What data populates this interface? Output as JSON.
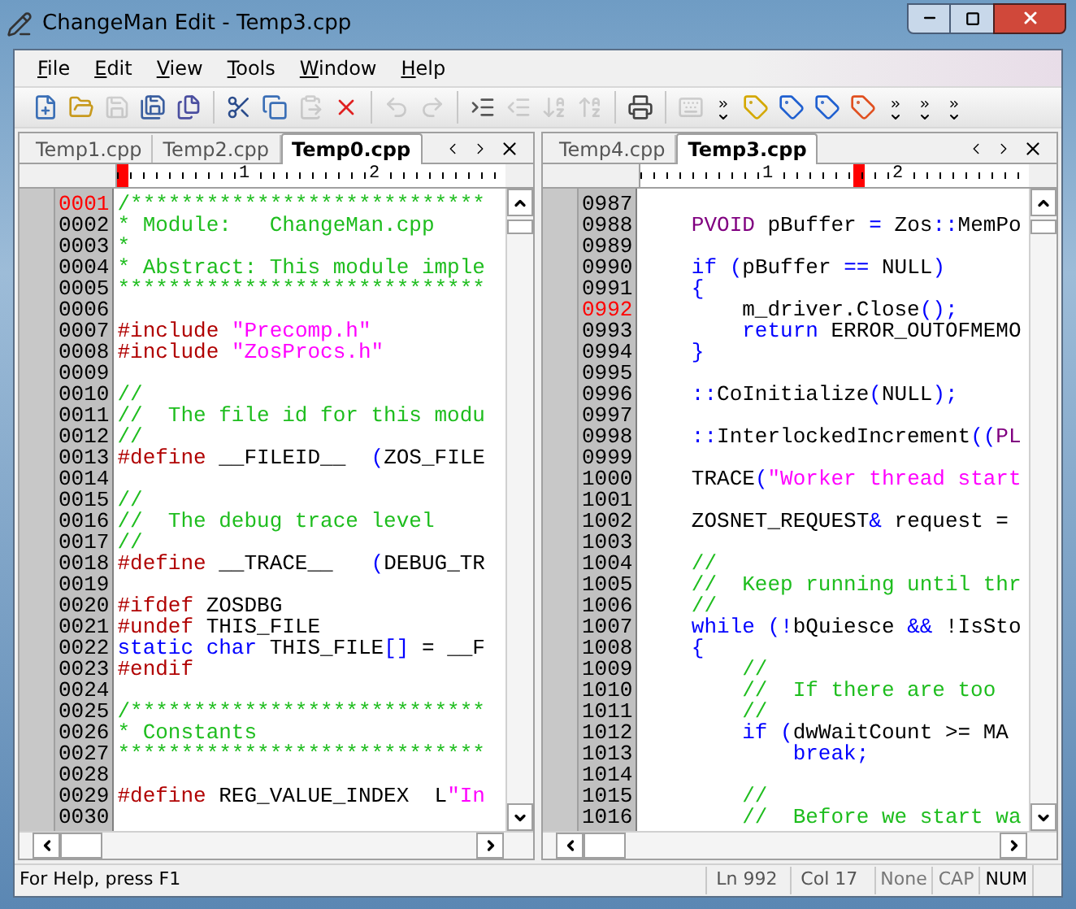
{
  "window": {
    "title": "ChangeMan Edit - Temp3.cpp"
  },
  "menu": [
    "File",
    "Edit",
    "View",
    "Tools",
    "Window",
    "Help"
  ],
  "toolbar": [
    {
      "kind": "new",
      "disabled": false
    },
    {
      "kind": "open",
      "disabled": false
    },
    {
      "kind": "save",
      "disabled": true
    },
    {
      "kind": "saveall",
      "disabled": false
    },
    {
      "kind": "saveas",
      "disabled": false
    },
    {
      "kind": "sep"
    },
    {
      "kind": "cut",
      "disabled": false
    },
    {
      "kind": "copy",
      "disabled": false
    },
    {
      "kind": "paste",
      "disabled": true
    },
    {
      "kind": "delete",
      "disabled": false
    },
    {
      "kind": "sep"
    },
    {
      "kind": "undo",
      "disabled": true
    },
    {
      "kind": "redo",
      "disabled": true
    },
    {
      "kind": "sep"
    },
    {
      "kind": "indent",
      "disabled": false
    },
    {
      "kind": "outdent",
      "disabled": true
    },
    {
      "kind": "sortdown",
      "disabled": true
    },
    {
      "kind": "sortup",
      "disabled": true
    },
    {
      "kind": "sep"
    },
    {
      "kind": "print",
      "disabled": false
    },
    {
      "kind": "sep"
    },
    {
      "kind": "keyboard",
      "disabled": true
    },
    {
      "kind": "grip"
    },
    {
      "kind": "tag",
      "disabled": false
    },
    {
      "kind": "tagnext",
      "disabled": false
    },
    {
      "kind": "tagprev",
      "disabled": false
    },
    {
      "kind": "tagclear",
      "disabled": false
    },
    {
      "kind": "grip"
    },
    {
      "kind": "grip"
    },
    {
      "kind": "grip"
    }
  ],
  "panes": [
    {
      "tabs": [
        {
          "label": "Temp1.cpp",
          "selected": false
        },
        {
          "label": "Temp2.cpp",
          "selected": false
        },
        {
          "label": "Temp0.cpp",
          "selected": true
        }
      ],
      "ruler": {
        "marks": [
          "1",
          "2"
        ],
        "level": 0
      },
      "lines": [
        {
          "no": "0001",
          "current": true,
          "tokens": [
            {
              "kind": "comment",
              "text": "/****************************"
            }
          ]
        },
        {
          "no": "0002",
          "current": false,
          "tokens": [
            {
              "kind": "comment",
              "text": "* Module:   ChangeMan.cpp"
            }
          ]
        },
        {
          "no": "0003",
          "current": false,
          "tokens": [
            {
              "kind": "comment",
              "text": "*"
            }
          ]
        },
        {
          "no": "0004",
          "current": false,
          "tokens": [
            {
              "kind": "comment",
              "text": "* Abstract: This module imple"
            }
          ]
        },
        {
          "no": "0005",
          "current": false,
          "tokens": [
            {
              "kind": "comment",
              "text": "*****************************"
            }
          ]
        },
        {
          "no": "0006",
          "current": false
        },
        {
          "no": "0007",
          "current": false,
          "tokens": [
            {
              "kind": "preproc",
              "text": "#include"
            },
            {
              "kind": "string",
              "text": " \"Precomp.h\""
            }
          ]
        },
        {
          "no": "0008",
          "current": false,
          "tokens": [
            {
              "kind": "preproc",
              "text": "#include"
            },
            {
              "kind": "string",
              "text": " \"ZosProcs.h\""
            }
          ]
        },
        {
          "no": "0009",
          "current": false
        },
        {
          "no": "0010",
          "current": false,
          "tokens": [
            {
              "kind": "comment",
              "text": "//"
            }
          ]
        },
        {
          "no": "0011",
          "current": false,
          "tokens": [
            {
              "kind": "comment",
              "text": "//  The file id for this modu"
            }
          ]
        },
        {
          "no": "0012",
          "current": false,
          "tokens": [
            {
              "kind": "comment",
              "text": "//"
            }
          ]
        },
        {
          "no": "0013",
          "current": false,
          "tokens": [
            {
              "kind": "preproc",
              "text": "#define"
            },
            {
              "kind": "plain",
              "text": " __FILEID__  "
            },
            {
              "kind": "keyword",
              "text": "("
            },
            {
              "kind": "plain",
              "text": "ZOS_FILE"
            }
          ]
        },
        {
          "no": "0014",
          "current": false
        },
        {
          "no": "0015",
          "current": false,
          "tokens": [
            {
              "kind": "comment",
              "text": "//"
            }
          ]
        },
        {
          "no": "0016",
          "current": false,
          "tokens": [
            {
              "kind": "comment",
              "text": "//  The debug trace level"
            }
          ]
        },
        {
          "no": "0017",
          "current": false,
          "tokens": [
            {
              "kind": "comment",
              "text": "//"
            }
          ]
        },
        {
          "no": "0018",
          "current": false,
          "tokens": [
            {
              "kind": "preproc",
              "text": "#define"
            },
            {
              "kind": "plain",
              "text": " __TRACE__   "
            },
            {
              "kind": "keyword",
              "text": "("
            },
            {
              "kind": "plain",
              "text": "DEBUG_TR"
            }
          ]
        },
        {
          "no": "0019",
          "current": false
        },
        {
          "no": "0020",
          "current": false,
          "tokens": [
            {
              "kind": "preproc",
              "text": "#ifdef"
            },
            {
              "kind": "plain",
              "text": " ZOSDBG"
            }
          ]
        },
        {
          "no": "0021",
          "current": false,
          "tokens": [
            {
              "kind": "preproc",
              "text": "#undef"
            },
            {
              "kind": "plain",
              "text": " THIS_FILE"
            }
          ]
        },
        {
          "no": "0022",
          "current": false,
          "tokens": [
            {
              "kind": "keyword",
              "text": "static char"
            },
            {
              "kind": "plain",
              "text": " THIS_FILE"
            },
            {
              "kind": "keyword",
              "text": "[]"
            },
            {
              "kind": "plain",
              "text": " = __F"
            }
          ]
        },
        {
          "no": "0023",
          "current": false,
          "tokens": [
            {
              "kind": "preproc",
              "text": "#endif"
            }
          ]
        },
        {
          "no": "0024",
          "current": false
        },
        {
          "no": "0025",
          "current": false,
          "tokens": [
            {
              "kind": "comment",
              "text": "/****************************"
            }
          ]
        },
        {
          "no": "0026",
          "current": false,
          "tokens": [
            {
              "kind": "comment",
              "text": "* Constants"
            }
          ]
        },
        {
          "no": "0027",
          "current": false,
          "tokens": [
            {
              "kind": "comment",
              "text": "*****************************"
            }
          ]
        },
        {
          "no": "0028",
          "current": false
        },
        {
          "no": "0029",
          "current": false,
          "tokens": [
            {
              "kind": "preproc",
              "text": "#define"
            },
            {
              "kind": "plain",
              "text": " REG_VALUE_INDEX  L"
            },
            {
              "kind": "string",
              "text": "\"In"
            }
          ]
        },
        {
          "no": "0030",
          "current": false
        }
      ]
    },
    {
      "tabs": [
        {
          "label": "Temp4.cpp",
          "selected": false
        },
        {
          "label": "Temp3.cpp",
          "selected": true
        }
      ],
      "ruler": {
        "marks": [
          "1",
          "2"
        ],
        "level": 0.55
      },
      "lines": [
        {
          "no": "0987",
          "current": false
        },
        {
          "no": "0988",
          "current": false,
          "tokens": [
            {
              "kind": "type",
              "text": "    PVOID"
            },
            {
              "kind": "plain",
              "text": " pBuffer "
            },
            {
              "kind": "keyword",
              "text": "="
            },
            {
              "kind": "plain",
              "text": " Zos"
            },
            {
              "kind": "keyword",
              "text": "::"
            },
            {
              "kind": "plain",
              "text": "MemPo"
            }
          ]
        },
        {
          "no": "0989",
          "current": false
        },
        {
          "no": "0990",
          "current": false,
          "tokens": [
            {
              "kind": "keyword",
              "text": "    if ("
            },
            {
              "kind": "plain",
              "text": "pBuffer "
            },
            {
              "kind": "keyword",
              "text": "=="
            },
            {
              "kind": "plain",
              "text": " NULL"
            },
            {
              "kind": "keyword",
              "text": ")"
            }
          ]
        },
        {
          "no": "0991",
          "current": false,
          "tokens": [
            {
              "kind": "keyword",
              "text": "    {"
            }
          ]
        },
        {
          "no": "0992",
          "current": true,
          "tokens": [
            {
              "kind": "plain",
              "text": "        m_driver.Close"
            },
            {
              "kind": "keyword",
              "text": "();"
            }
          ]
        },
        {
          "no": "0993",
          "current": false,
          "tokens": [
            {
              "kind": "keyword",
              "text": "        return"
            },
            {
              "kind": "plain",
              "text": " ERROR_OUTOFMEMO"
            }
          ]
        },
        {
          "no": "0994",
          "current": false,
          "tokens": [
            {
              "kind": "keyword",
              "text": "    }"
            }
          ]
        },
        {
          "no": "0995",
          "current": false
        },
        {
          "no": "0996",
          "current": false,
          "tokens": [
            {
              "kind": "keyword",
              "text": "    ::"
            },
            {
              "kind": "plain",
              "text": "CoInitialize"
            },
            {
              "kind": "keyword",
              "text": "("
            },
            {
              "kind": "plain",
              "text": "NULL"
            },
            {
              "kind": "keyword",
              "text": ");"
            }
          ]
        },
        {
          "no": "0997",
          "current": false
        },
        {
          "no": "0998",
          "current": false,
          "tokens": [
            {
              "kind": "keyword",
              "text": "    ::"
            },
            {
              "kind": "plain",
              "text": "InterlockedIncrement"
            },
            {
              "kind": "keyword",
              "text": "(("
            },
            {
              "kind": "type",
              "text": "PL"
            }
          ]
        },
        {
          "no": "0999",
          "current": false
        },
        {
          "no": "1000",
          "current": false,
          "tokens": [
            {
              "kind": "plain",
              "text": "    TRACE"
            },
            {
              "kind": "keyword",
              "text": "("
            },
            {
              "kind": "string",
              "text": "\"Worker thread start"
            }
          ]
        },
        {
          "no": "1001",
          "current": false
        },
        {
          "no": "1002",
          "current": false,
          "tokens": [
            {
              "kind": "plain",
              "text": "    ZOSNET_REQUEST"
            },
            {
              "kind": "keyword",
              "text": "&"
            },
            {
              "kind": "plain",
              "text": " request ="
            }
          ]
        },
        {
          "no": "1003",
          "current": false
        },
        {
          "no": "1004",
          "current": false,
          "tokens": [
            {
              "kind": "comment",
              "text": "    //"
            }
          ]
        },
        {
          "no": "1005",
          "current": false,
          "tokens": [
            {
              "kind": "comment",
              "text": "    //  Keep running until thr"
            }
          ]
        },
        {
          "no": "1006",
          "current": false,
          "tokens": [
            {
              "kind": "comment",
              "text": "    //"
            }
          ]
        },
        {
          "no": "1007",
          "current": false,
          "tokens": [
            {
              "kind": "keyword",
              "text": "    while (!"
            },
            {
              "kind": "plain",
              "text": "bQuiesce "
            },
            {
              "kind": "keyword",
              "text": "&&"
            },
            {
              "kind": "plain",
              "text": " !IsSto"
            }
          ]
        },
        {
          "no": "1008",
          "current": false,
          "tokens": [
            {
              "kind": "keyword",
              "text": "    {"
            }
          ]
        },
        {
          "no": "1009",
          "current": false,
          "tokens": [
            {
              "kind": "comment",
              "text": "        //"
            }
          ]
        },
        {
          "no": "1010",
          "current": false,
          "tokens": [
            {
              "kind": "comment",
              "text": "        //  If there are too"
            }
          ]
        },
        {
          "no": "1011",
          "current": false,
          "tokens": [
            {
              "kind": "comment",
              "text": "        //"
            }
          ]
        },
        {
          "no": "1012",
          "current": false,
          "tokens": [
            {
              "kind": "keyword",
              "text": "        if ("
            },
            {
              "kind": "plain",
              "text": "dwWaitCount >= MA"
            }
          ]
        },
        {
          "no": "1013",
          "current": false,
          "tokens": [
            {
              "kind": "keyword",
              "text": "            break;"
            }
          ]
        },
        {
          "no": "1014",
          "current": false
        },
        {
          "no": "1015",
          "current": false,
          "tokens": [
            {
              "kind": "comment",
              "text": "        //"
            }
          ]
        },
        {
          "no": "1016",
          "current": false,
          "tokens": [
            {
              "kind": "comment",
              "text": "        //  Before we start wa"
            }
          ]
        }
      ]
    }
  ],
  "status_bar": {
    "message": "For Help, press F1",
    "line": "Ln 992",
    "column": "Col 17",
    "indicators": [
      {
        "label": "None",
        "on": false
      },
      {
        "label": "CAP",
        "on": false
      },
      {
        "label": "NUM",
        "on": true
      }
    ]
  }
}
